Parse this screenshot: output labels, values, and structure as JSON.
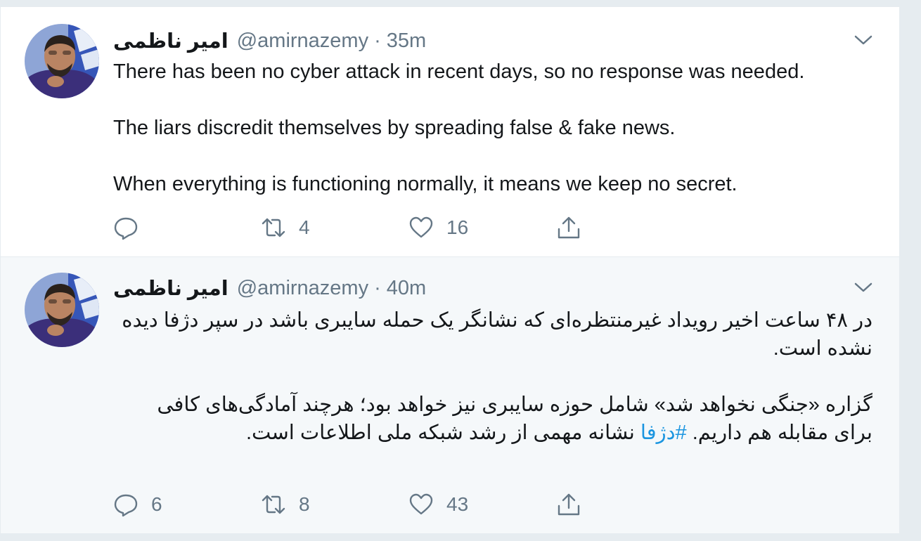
{
  "tweets": [
    {
      "display_name": "امیر ناظمی",
      "handle": "@amirnazemy",
      "separator": "·",
      "time": "35m",
      "paragraphs": [
        "There has been no cyber attack in recent days, so no response was needed.",
        "The liars discredit themselves by spreading false & fake news.",
        "When everything is functioning normally, it means we keep no secret."
      ],
      "reply_count": "",
      "retweet_count": "4",
      "like_count": "16"
    },
    {
      "display_name": "امیر ناظمی",
      "handle": "@amirnazemy",
      "separator": "·",
      "time": "40m",
      "p1": "در ۴۸ ساعت اخیر رویداد غیرمنتظره‌ای که نشانگر یک حمله سایبری باشد در سپر دژفا دیده نشده است.",
      "p2_before": "گزاره «جنگی نخواهد شد» شامل حوزه سایبری نیز خواهد بود؛ هرچند آمادگی‌های کافی برای مقابله هم داریم.",
      "hashtag": "#دژفا",
      "p2_after": "نشانه مهمی از رشد شبکه ملی اطلاعات است.",
      "reply_count": "6",
      "retweet_count": "8",
      "like_count": "43"
    }
  ],
  "colors": {
    "text": "#14171a",
    "secondary": "#657786",
    "link": "#1b95e0",
    "background": "#e6ecf0",
    "highlight_row": "#f5f8fa"
  },
  "icons": [
    "reply-icon",
    "retweet-icon",
    "like-icon",
    "share-icon",
    "caret-down-icon"
  ]
}
